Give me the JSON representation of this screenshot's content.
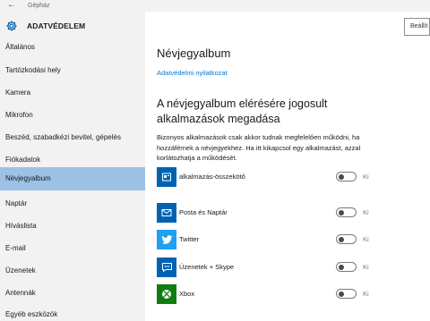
{
  "window": {
    "title": "Gépház"
  },
  "sidebar": {
    "section_title": "ADATVÉDELEM",
    "items": [
      {
        "label": "Általános"
      },
      {
        "label": "Tartózkodási hely"
      },
      {
        "label": "Kamera"
      },
      {
        "label": "Mikrofon"
      },
      {
        "label": "Beszéd, szabadkézi bevitel, gépelés"
      },
      {
        "label": "Fiókadatok"
      },
      {
        "label": "Névjegyalbum"
      },
      {
        "label": "Naptár"
      },
      {
        "label": "Híváslista"
      },
      {
        "label": "E-mail"
      },
      {
        "label": "Üzenetek"
      },
      {
        "label": "Antennák"
      },
      {
        "label": "Egyéb eszközök"
      }
    ],
    "selected_index": 6,
    "selected_color": "#9dc2e6"
  },
  "search": {
    "value": "Beállít"
  },
  "main": {
    "title": "Névjegyalbum",
    "privacy_link": "Adatvédelmi nyilatkozat",
    "subhead": "A névjegyalbum elérésére jogosult alkalmazások megadása",
    "description": "Bizonyos alkalmazások csak akkor tudnak megfelelően működni, ha hozzáférnek a névjegyekhez. Ha itt kikapcsol egy alkalmazást, azzal korlátozhatja a működését.",
    "apps": [
      {
        "name": "alkalmazás-összekötő",
        "icon": "app-connector-icon",
        "tile_color": "#0063b1",
        "state": "Ki"
      },
      {
        "name": "Posta és Naptár",
        "icon": "mail-icon",
        "tile_color": "#0063b1",
        "state": "Ki"
      },
      {
        "name": "Twitter",
        "icon": "twitter-bird-icon",
        "tile_color": "#1da1f2",
        "state": "Ki"
      },
      {
        "name": "Üzenetek + Skype",
        "icon": "messaging-icon",
        "tile_color": "#0063b1",
        "state": "Ki"
      },
      {
        "name": "Xbox",
        "icon": "xbox-icon",
        "tile_color": "#107c10",
        "state": "Ki"
      }
    ]
  },
  "colors": {
    "accent": "#0078d7",
    "sidebar_bg": "#f2f2f2"
  }
}
